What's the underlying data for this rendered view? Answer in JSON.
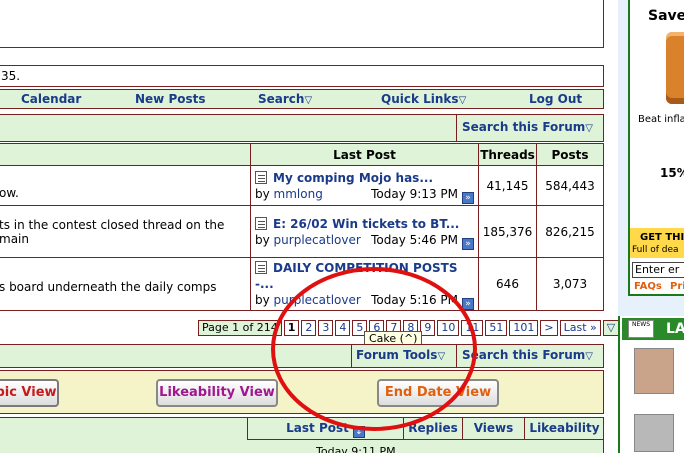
{
  "info_line": "35.",
  "navbar": {
    "calendar": "Calendar",
    "new_posts": "New Posts",
    "search": "Search",
    "quick_links": "Quick Links",
    "logout": "Log Out"
  },
  "search_forum": "Search this Forum",
  "forum_table": {
    "headers": [
      "Last Post",
      "Threads",
      "Posts"
    ],
    "rows": [
      {
        "desc": "ow.",
        "title": "My comping Mojo has...",
        "by": "by",
        "user": "mmlong",
        "time": "Today 9:13 PM",
        "threads": "41,145",
        "posts": "584,443"
      },
      {
        "desc": "ts in the contest closed thread on the main",
        "title": "E: 26/02 Win tickets to BT...",
        "by": "by",
        "user": "purplecatlover",
        "time": "Today 5:46 PM",
        "threads": "185,376",
        "posts": "826,215"
      },
      {
        "desc": "s board underneath the daily comps",
        "title": "DAILY COMPETITION POSTS -...",
        "by": "by",
        "user": "purplecatlover",
        "time": "Today 5:16 PM",
        "threads": "646",
        "posts": "3,073"
      }
    ]
  },
  "pagination": {
    "label": "Page 1 of 214",
    "pages": [
      "1",
      "2",
      "3",
      "4",
      "5",
      "6",
      "7",
      "8",
      "9",
      "10",
      "11",
      "51",
      "101",
      ">",
      "Last »"
    ]
  },
  "tooltip": "Cake (^)",
  "forum_tools": "Forum Tools",
  "search_forum_2": "Search this Forum",
  "views": {
    "topic": "pic View",
    "likeability": "Likeability View",
    "end_date": "End Date View"
  },
  "thread_headers": [
    "Last Post",
    "Replies",
    "Views",
    "Likeability"
  ],
  "thread_partial_time": "Today 9:11 PM",
  "sidebar": {
    "save_title": "Save",
    "beat_text": "Beat infla",
    "percent": "15%",
    "get_text": "GET THI",
    "full_text": "Full of dea",
    "enter_placeholder": "Enter er",
    "faqs": "FAQs",
    "pri": "Pri",
    "news_badge": "NEWS",
    "la": "LA"
  },
  "colors": {
    "accent_border": "#7a1f1f",
    "header_bg": "#dff3d8",
    "link": "#1a3a8a",
    "ellipse": "#e01010"
  }
}
